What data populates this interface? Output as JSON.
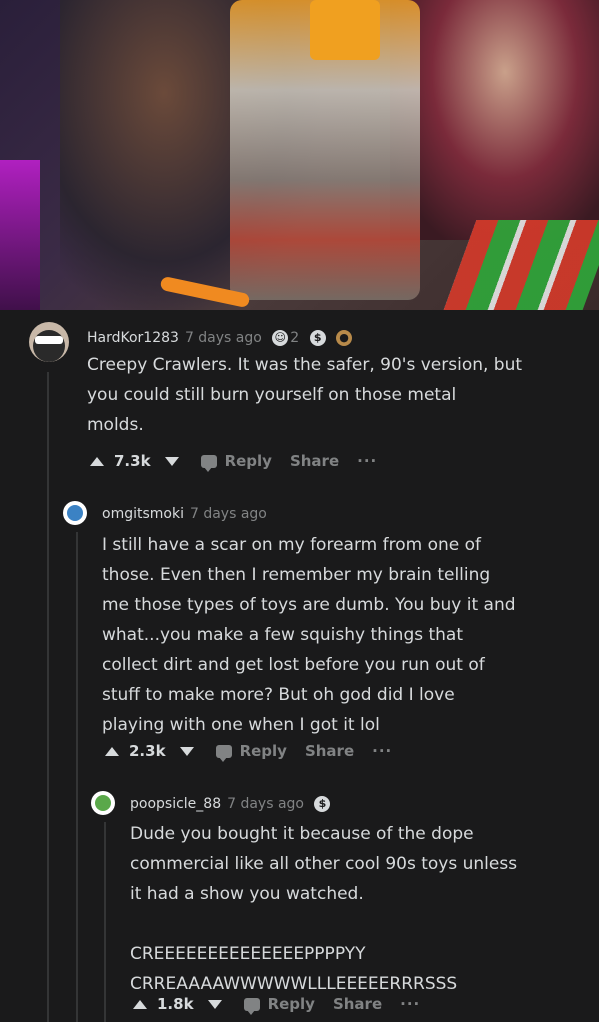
{
  "comments": [
    {
      "username": "HardKor1283",
      "time": "7 days ago",
      "award_count": "2",
      "body": "Creepy Crawlers. It was the safer, 90's version, but\nyou could still burn yourself on those metal\nmolds.",
      "score": "7.3k",
      "reply_label": "Reply",
      "share_label": "Share",
      "more_label": "···"
    },
    {
      "username": "omgitsmoki",
      "time": "7 days ago",
      "body": "I still have a scar on my forearm from one of\nthose. Even then I remember my brain telling\nme those types of toys are dumb. You buy it and\nwhat...you make a few squishy things that\ncollect dirt and get lost before you run out of\nstuff to make more? But oh god did I love\nplaying with one when I got it lol",
      "score": "2.3k",
      "reply_label": "Reply",
      "share_label": "Share",
      "more_label": "···"
    },
    {
      "username": "poopsicle_88",
      "time": "7 days ago",
      "body": "Dude you bought it because of the dope\ncommercial like all other cool 90s toys unless\nit had a show you watched.\n\nCREEEEEEEEEEEEEEPPPPYY\nCRREAAAAWWWWWLLLEEEEERRRSSS",
      "score": "1.8k",
      "reply_label": "Reply",
      "share_label": "Share",
      "more_label": "···"
    }
  ],
  "colors": {
    "background": "#1a1a1b",
    "text": "#d7dadc",
    "muted": "#818384",
    "thread_line": "#343536"
  }
}
